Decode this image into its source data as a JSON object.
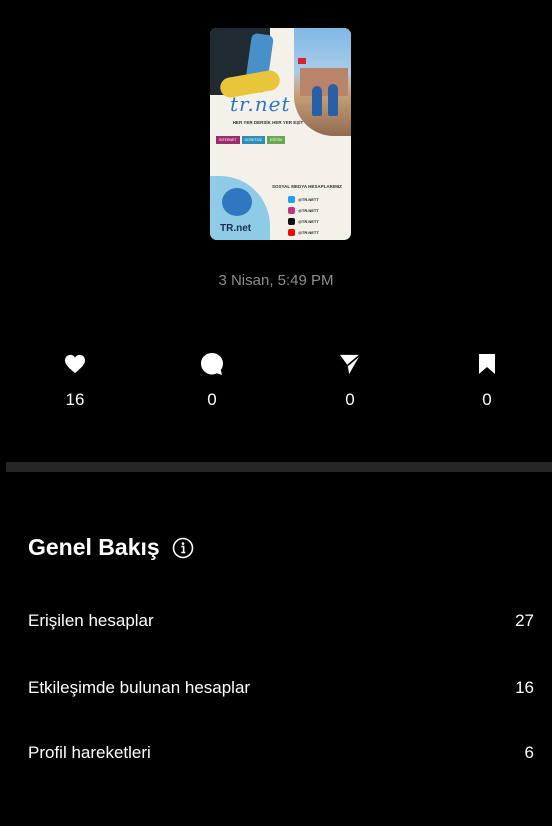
{
  "post": {
    "thumbnail": {
      "brand": "tr.net",
      "slogan": "HER YER DERSİK HER YER EŞİT",
      "tags": [
        "İNTERNET",
        "ÜCRETSİZ",
        "EĞİTİM"
      ],
      "social_title": "SOSYAL MEDYA HESAPLARIMIZ",
      "social_handles": [
        "@TR.NETT",
        "@TR.NETT",
        "@TR.NETT",
        "@TR.NETT"
      ],
      "logo_text": "TR.net",
      "colors": [
        "#1da1f2",
        "#c13584",
        "#111111",
        "#ff0000"
      ]
    },
    "timestamp": "3 Nisan, 5:49 PM"
  },
  "stats": [
    {
      "icon": "heart-icon",
      "count": "16"
    },
    {
      "icon": "comment-icon",
      "count": "0"
    },
    {
      "icon": "share-icon",
      "count": "0"
    },
    {
      "icon": "bookmark-icon",
      "count": "0"
    }
  ],
  "overview": {
    "title": "Genel Bakış",
    "rows": [
      {
        "label": "Erişilen hesaplar",
        "value": "27"
      },
      {
        "label": "Etkileşimde bulunan hesaplar",
        "value": "16"
      },
      {
        "label": "Profil hareketleri",
        "value": "6"
      }
    ]
  }
}
